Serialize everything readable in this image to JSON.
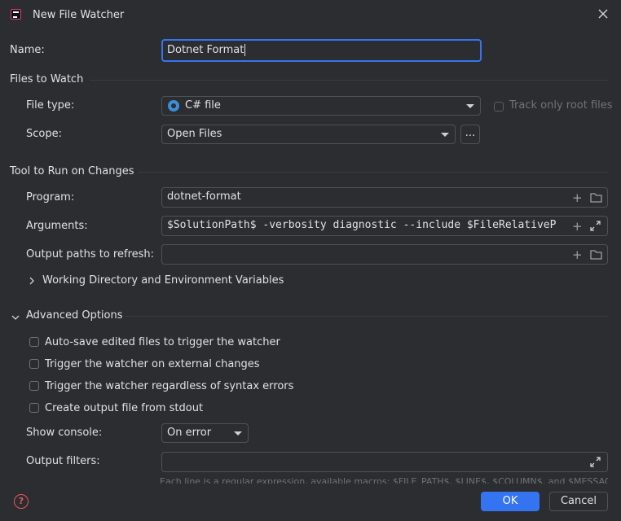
{
  "window": {
    "title": "New File Watcher"
  },
  "name_field": {
    "label": "Name:",
    "value": "Dotnet Format"
  },
  "files_to_watch": {
    "header": "Files to Watch",
    "file_type": {
      "label": "File type:",
      "value": "C# file",
      "icon": "csharp-file-icon"
    },
    "track_root": {
      "label": "Track only root files",
      "checked": false
    },
    "scope": {
      "label": "Scope:",
      "value": "Open Files",
      "browse_label": "..."
    }
  },
  "tool": {
    "header": "Tool to Run on Changes",
    "program": {
      "label": "Program:",
      "value": "dotnet-format"
    },
    "arguments": {
      "label": "Arguments:",
      "value": "$SolutionPath$ -verbosity diagnostic --include $FileRelativeP"
    },
    "output_paths": {
      "label": "Output paths to refresh:",
      "value": ""
    },
    "working_dir": {
      "label": "Working Directory and Environment Variables"
    }
  },
  "advanced": {
    "header": "Advanced Options",
    "checkboxes": [
      {
        "label": "Auto-save edited files to trigger the watcher",
        "checked": false
      },
      {
        "label": "Trigger the watcher on external changes",
        "checked": false
      },
      {
        "label": "Trigger the watcher regardless of syntax errors",
        "checked": false
      },
      {
        "label": "Create output file from stdout",
        "checked": false
      }
    ],
    "show_console": {
      "label": "Show console:",
      "value": "On error"
    },
    "output_filters": {
      "label": "Output filters:",
      "value": ""
    },
    "hint": "Each line is a regular expression, available macros: $FILE_PATH$, $LINE$, $COLUMN$, and $MESSAGE$."
  },
  "footer": {
    "ok_label": "OK",
    "cancel_label": "Cancel"
  },
  "colors": {
    "accent": "#3574f0",
    "background": "#2b2d30",
    "border": "#4e5157",
    "help": "#e55765"
  }
}
